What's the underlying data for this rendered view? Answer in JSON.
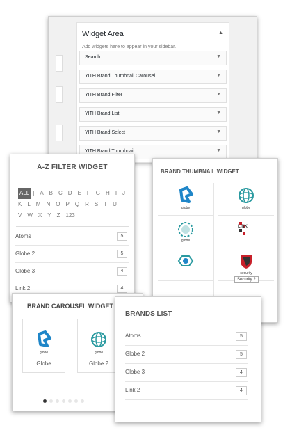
{
  "widget_area": {
    "title": "Widget Area",
    "description": "Add widgets here to appear in your sidebar.",
    "widgets": [
      {
        "label": "Search"
      },
      {
        "label": "YITH Brand Thumbnail Carousel"
      },
      {
        "label": "YITH Brand Filter"
      },
      {
        "label": "YITH Brand List"
      },
      {
        "label": "YITH Brand Select"
      },
      {
        "label": "YITH Brand Thumbnail"
      }
    ]
  },
  "az_filter": {
    "title": "A-Z FILTER WIDGET",
    "letters": [
      "ALL",
      "A",
      "B",
      "C",
      "D",
      "E",
      "F",
      "G",
      "H",
      "I",
      "J",
      "K",
      "L",
      "M",
      "N",
      "O",
      "P",
      "Q",
      "R",
      "S",
      "T",
      "U",
      "V",
      "W",
      "X",
      "Y",
      "Z",
      "123"
    ],
    "separator": "|",
    "brands": [
      {
        "name": "Atoms",
        "count": "5"
      },
      {
        "name": "Globe 2",
        "count": "5"
      },
      {
        "name": "Globe 3",
        "count": "4"
      },
      {
        "name": "Link 2",
        "count": "4"
      }
    ]
  },
  "brand_thumbnail": {
    "title": "BRAND THUMBNAIL WIDGET",
    "logos": [
      {
        "text": "globe",
        "color": "#1f86c8"
      },
      {
        "text": "globe",
        "color": "#2a9aa0"
      },
      {
        "text": "globe",
        "color": "#2a9aa0"
      },
      {
        "text": "LINK",
        "color": "#c8202a"
      },
      {
        "text": "",
        "color": "#2a9aa0"
      },
      {
        "text": "security",
        "color": "#c8202a"
      }
    ],
    "tooltip": "Security 2"
  },
  "brand_carousel": {
    "title": "BRAND CAROUSEL WIDGET",
    "slides": [
      {
        "logo_text": "globe",
        "name": "Globe"
      },
      {
        "logo_text": "globe",
        "name": "Globe 2"
      }
    ]
  },
  "brands_list": {
    "title": "BRANDS LIST",
    "brands": [
      {
        "name": "Atoms",
        "count": "5"
      },
      {
        "name": "Globe 2",
        "count": "5"
      },
      {
        "name": "Globe 3",
        "count": "4"
      },
      {
        "name": "Link 2",
        "count": "4"
      }
    ]
  },
  "colors": {
    "blue": "#1f86c8",
    "teal": "#2a9aa0",
    "red": "#c8202a"
  }
}
